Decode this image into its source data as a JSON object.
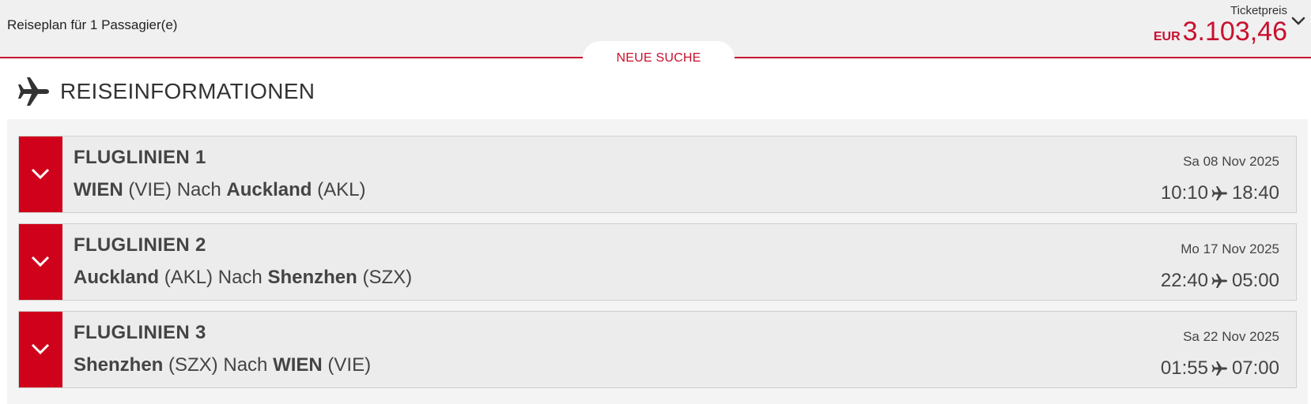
{
  "header": {
    "itinerary": "Reiseplan für 1 Passagier(e)",
    "price_label": "Ticketpreis",
    "currency": "EUR",
    "amount": "3.103,46",
    "new_search": "NEUE SUCHE"
  },
  "section": {
    "title": "REISEINFORMATIONEN",
    "icon": "airplane-icon"
  },
  "flights": [
    {
      "title": "FLUGLINIEN 1",
      "from_city": "WIEN",
      "from_code": "(VIE)",
      "connector": "Nach",
      "to_city": "Auckland",
      "to_code": "(AKL)",
      "date": "Sa 08 Nov 2025",
      "depart": "10:10",
      "arrive": "18:40"
    },
    {
      "title": "FLUGLINIEN 2",
      "from_city": "Auckland",
      "from_code": "(AKL)",
      "connector": "Nach",
      "to_city": "Shenzhen",
      "to_code": "(SZX)",
      "date": "Mo 17 Nov 2025",
      "depart": "22:40",
      "arrive": "05:00"
    },
    {
      "title": "FLUGLINIEN 3",
      "from_city": "Shenzhen",
      "from_code": "(SZX)",
      "connector": "Nach",
      "to_city": "WIEN",
      "to_code": "(VIE)",
      "date": "Sa 22 Nov 2025",
      "depart": "01:55",
      "arrive": "07:00"
    }
  ],
  "colors": {
    "accent": "#c8102e",
    "toggle": "#d0021b",
    "card_bg": "#ececec"
  }
}
